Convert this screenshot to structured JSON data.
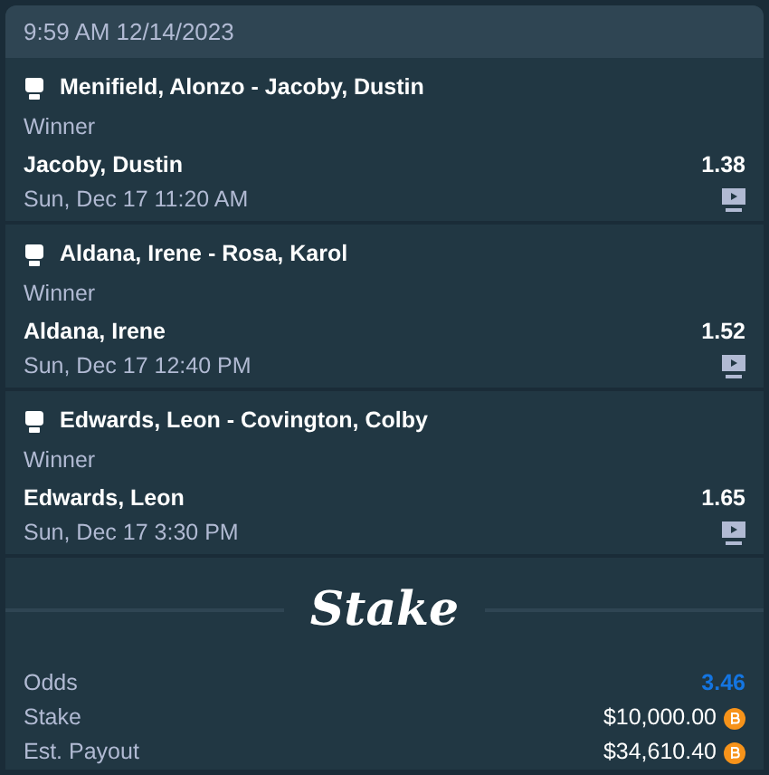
{
  "header": {
    "timestamp": "9:59 AM 12/14/2023"
  },
  "legs": [
    {
      "event": "Menifield, Alonzo - Jacoby, Dustin",
      "market": "Winner",
      "selection": "Jacoby, Dustin",
      "odds": "1.38",
      "start": "Sun, Dec 17 11:20 AM"
    },
    {
      "event": "Aldana, Irene - Rosa, Karol",
      "market": "Winner",
      "selection": "Aldana, Irene",
      "odds": "1.52",
      "start": "Sun, Dec 17 12:40 PM"
    },
    {
      "event": "Edwards, Leon - Covington, Colby",
      "market": "Winner",
      "selection": "Edwards, Leon",
      "odds": "1.65",
      "start": "Sun, Dec 17 3:30 PM"
    }
  ],
  "logo": "Stake",
  "summary": [
    {
      "label": "Odds",
      "value": "3.46",
      "kind": "odds"
    },
    {
      "label": "Stake",
      "value": "$10,000.00",
      "kind": "amount"
    },
    {
      "label": "Est. Payout",
      "value": "$34,610.40",
      "kind": "amount"
    }
  ]
}
